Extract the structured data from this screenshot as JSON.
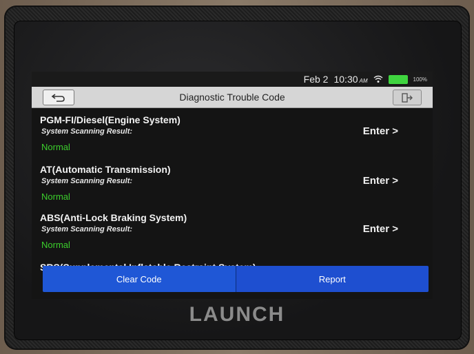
{
  "status": {
    "date": "Feb 2",
    "time": "10:30",
    "ampm": "AM",
    "battery": "100%"
  },
  "header": {
    "title": "Diagnostic Trouble Code"
  },
  "systems": [
    {
      "name": "PGM-FI/Diesel(Engine System)",
      "label": "System Scanning Result:",
      "status": "Normal",
      "action": "Enter >"
    },
    {
      "name": "AT(Automatic Transmission)",
      "label": "System Scanning Result:",
      "status": "Normal",
      "action": "Enter >"
    },
    {
      "name": "ABS(Anti-Lock Braking System)",
      "label": "System Scanning Result:",
      "status": "Normal",
      "action": "Enter >"
    }
  ],
  "partial_system": "SRS(Supplemental Inflatable Restraint System)",
  "footer": {
    "clear_label": "Clear Code",
    "report_label": "Report"
  },
  "device": {
    "brand": "LAUNCH"
  },
  "colors": {
    "accent": "#1f57d6",
    "normal_status": "#3ccf2c"
  }
}
